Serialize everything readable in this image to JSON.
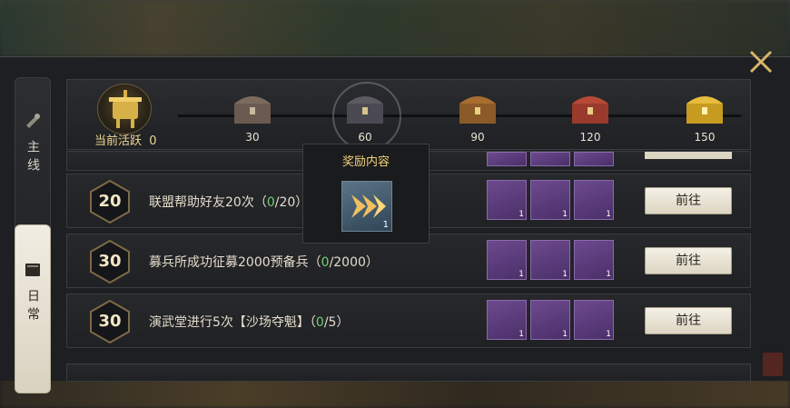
{
  "tabs": {
    "main_line": {
      "label": "主线",
      "icon": "scroll-icon"
    },
    "daily": {
      "label": "日常",
      "icon": "book-icon"
    }
  },
  "activity": {
    "label": "当前活跃",
    "current": "0",
    "milestones": [
      {
        "value": "30",
        "icon": "wooden-chest-icon"
      },
      {
        "value": "60",
        "icon": "iron-chest-icon"
      },
      {
        "value": "90",
        "icon": "bronze-chest-icon"
      },
      {
        "value": "120",
        "icon": "red-chest-icon"
      },
      {
        "value": "150",
        "icon": "golden-chest-icon"
      }
    ]
  },
  "tooltip": {
    "title": "奖励内容",
    "item_icon": "speedup-arrow-icon",
    "item_count": "1"
  },
  "quests": [
    {
      "score": "20",
      "text": "联盟帮助好友20次（",
      "current": "0",
      "total": "/20）",
      "go_label": "前往",
      "reward_count": "1"
    },
    {
      "score": "30",
      "text": "募兵所成功征募2000预备兵（",
      "current": "0",
      "total": "/2000）",
      "go_label": "前往",
      "reward_count": "1"
    },
    {
      "score": "30",
      "text": "演武堂进行5次【沙场夺魁】（",
      "current": "0",
      "total": "/5）",
      "go_label": "前往",
      "reward_count": "1"
    }
  ],
  "colors": {
    "accent_gold": "#f3d27a",
    "progress_green": "#6fd16f",
    "reward_bg_purple": "#5a3a7c"
  }
}
